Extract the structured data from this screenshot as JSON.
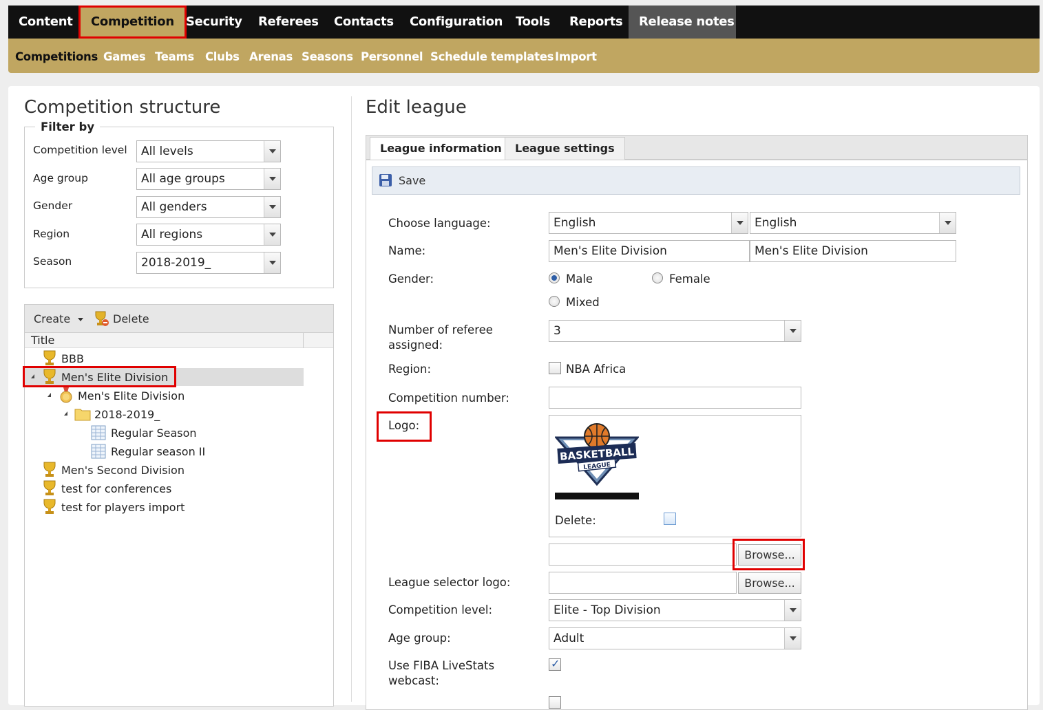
{
  "topnav": {
    "items": [
      "Content",
      "Competition",
      "Security",
      "Referees",
      "Contacts",
      "Configuration",
      "Tools",
      "Reports",
      "Release notes"
    ],
    "active": "Competition"
  },
  "subnav": {
    "items": [
      "Competitions",
      "Games",
      "Teams",
      "Clubs",
      "Arenas",
      "Seasons",
      "Personnel",
      "Schedule templates",
      "Import"
    ],
    "active": "Competitions"
  },
  "left": {
    "title": "Competition structure",
    "filter_legend": "Filter by",
    "filters": [
      {
        "label": "Competition level",
        "value": "All levels"
      },
      {
        "label": "Age group",
        "value": "All age groups"
      },
      {
        "label": "Gender",
        "value": "All genders"
      },
      {
        "label": "Region",
        "value": "All regions"
      },
      {
        "label": "Season",
        "value": "2018-2019_"
      }
    ],
    "toolbar": {
      "create": "Create",
      "delete": "Delete"
    },
    "column_title": "Title",
    "tree": [
      {
        "label": "BBB"
      },
      {
        "label": "Men's Elite Division"
      },
      {
        "label": "Men's Elite Division"
      },
      {
        "label": "2018-2019_"
      },
      {
        "label": "Regular Season"
      },
      {
        "label": "Regular season II"
      },
      {
        "label": "Men's Second Division"
      },
      {
        "label": "test for conferences"
      },
      {
        "label": "test for players import"
      }
    ]
  },
  "right": {
    "title": "Edit league",
    "tabs": [
      "League information",
      "League settings"
    ],
    "save_label": "Save",
    "labels": {
      "language": "Choose language:",
      "name": "Name:",
      "gender": "Gender:",
      "referees": "Number of referee assigned:",
      "region": "Region:",
      "comp_number": "Competition number:",
      "logo": "Logo:",
      "delete": "Delete:",
      "selector_logo": "League selector logo:",
      "comp_level": "Competition level:",
      "age_group": "Age group:",
      "livestats": "Use FIBA LiveStats webcast:"
    },
    "language_1": "English",
    "language_2": "English",
    "name_1": "Men's Elite Division",
    "name_2": "Men's Elite Division",
    "gender_options": [
      "Male",
      "Female",
      "Mixed"
    ],
    "gender_selected": "Male",
    "referees_value": "3",
    "region_option": "NBA Africa",
    "comp_number_value": "",
    "logo_text_1": "BASKETBALL",
    "logo_text_2": "LEAGUE",
    "browse_label": "Browse...",
    "comp_level_value": "Elite - Top Division",
    "age_group_value": "Adult",
    "livestats_checked": true
  },
  "colors": {
    "nav_bg": "#111111",
    "gold": "#c0a661",
    "highlight": "#e00000",
    "accent_blue": "#2e5ea6"
  }
}
